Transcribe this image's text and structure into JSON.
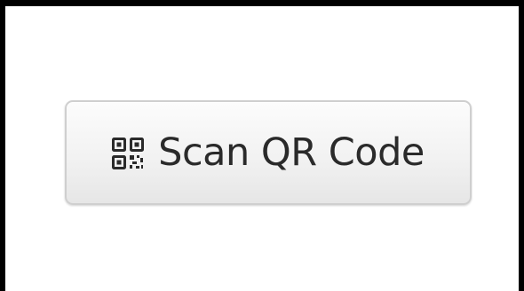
{
  "button": {
    "label": "Scan QR Code",
    "icon": "qr-code-icon"
  },
  "colors": {
    "frame": "#000000",
    "background": "#ffffff",
    "button_border": "#cfcfcf",
    "button_text": "#2a2a2a"
  }
}
